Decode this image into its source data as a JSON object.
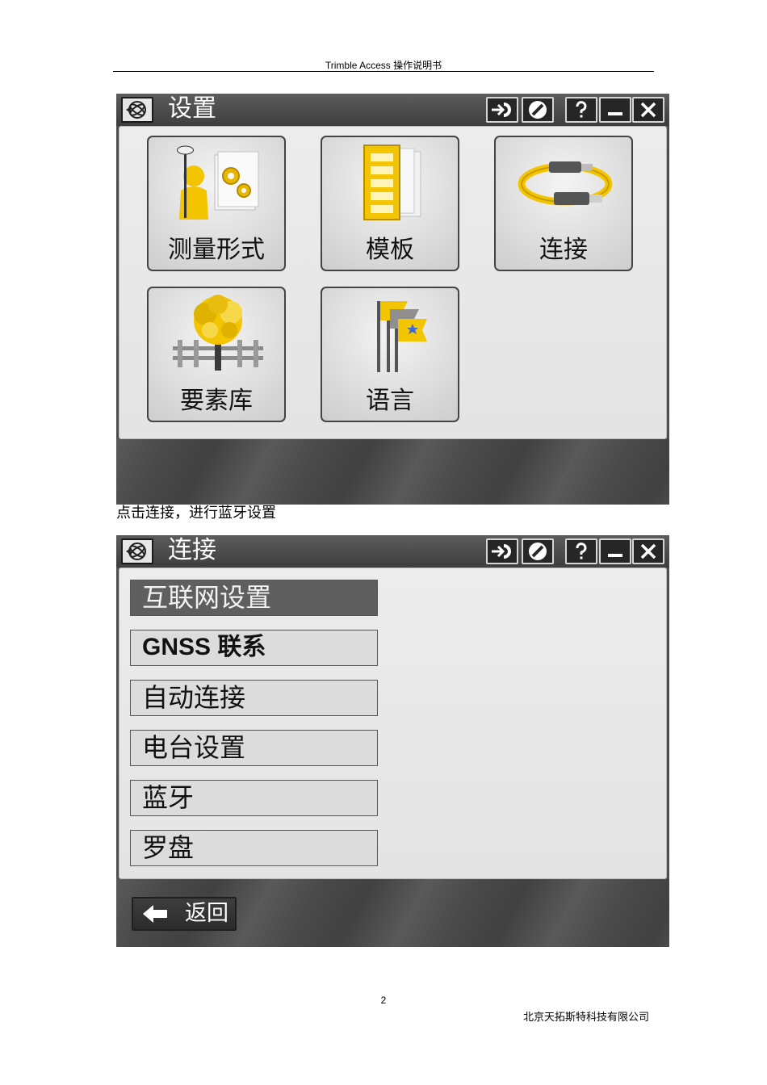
{
  "document": {
    "header": "Trimble Access  操作说明书",
    "caption": "点击连接，进行蓝牙设置",
    "page_number": "2",
    "company": "北京天拓斯特科技有限公司"
  },
  "settings_screen": {
    "title": "设置",
    "tiles": [
      {
        "label": "测量形式",
        "icon": "survey-styles-icon"
      },
      {
        "label": "模板",
        "icon": "templates-icon"
      },
      {
        "label": "连接",
        "icon": "cable-connect-icon"
      },
      {
        "label": "要素库",
        "icon": "feature-library-tree-icon"
      },
      {
        "label": "语言",
        "icon": "language-flags-icon"
      }
    ]
  },
  "connect_screen": {
    "title": "连接",
    "items": [
      "互联网设置",
      "GNSS 联系",
      "自动连接",
      "电台设置",
      "蓝牙",
      "罗盘"
    ],
    "selected_index": 0,
    "back_label": "返回"
  },
  "toolbar_icons": [
    "trimble-logo-icon",
    "switch-to-icon",
    "no-entry-icon",
    "help-icon",
    "minimize-icon",
    "close-icon"
  ],
  "colors": {
    "accent_yellow": "#f2c500",
    "titlebar": "#4a4a4a",
    "panel": "#e8e8e8"
  }
}
